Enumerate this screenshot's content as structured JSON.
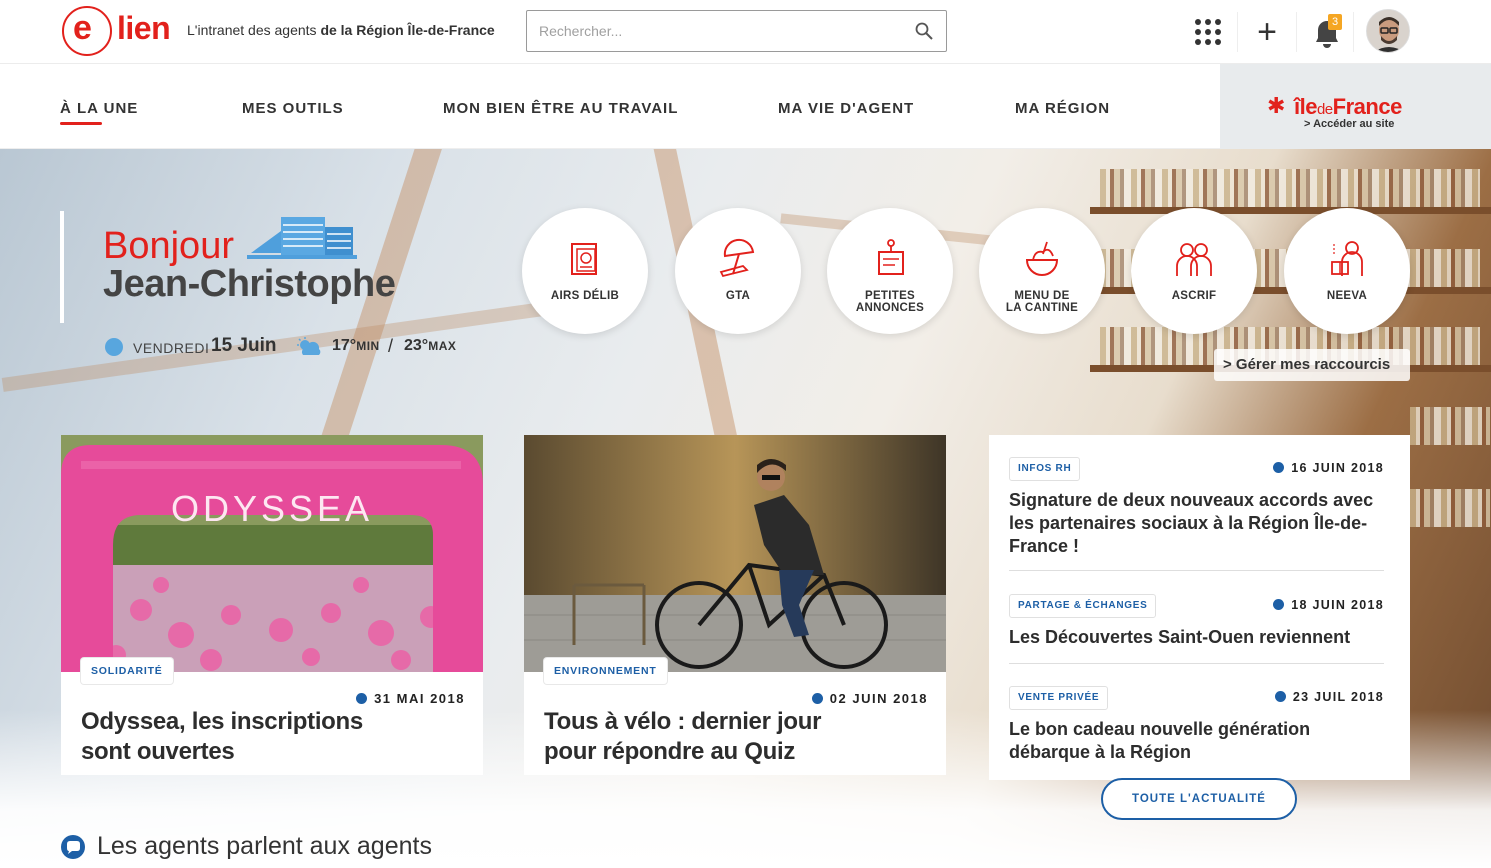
{
  "header": {
    "logo": "(e) lien",
    "tagline_prefix": "L'intranet des agents ",
    "tagline_bold": "de la Région Île-de-France",
    "search_placeholder": "Rechercher...",
    "notifications_count": "3",
    "apps_icon": "grid-icon",
    "add_icon": "plus-icon",
    "bell_icon": "bell-icon"
  },
  "nav": {
    "items": [
      {
        "label": "À LA UNE",
        "active": true
      },
      {
        "label": "MES OUTILS"
      },
      {
        "label": "MON BIEN ÊTRE AU TRAVAIL"
      },
      {
        "label": "MA VIE D'AGENT"
      },
      {
        "label": "MA RÉGION"
      }
    ],
    "region_logo_a": "île",
    "region_logo_b": "de",
    "region_logo_c": "France",
    "region_link": "> Accéder au site"
  },
  "greeting": {
    "hello": "Bonjour",
    "name": "Jean-Christophe",
    "day": "Vendredi",
    "date": "15 Juin",
    "tmin": "17°",
    "tmin_unit": "MIN",
    "tsep": "/",
    "tmax": "23°",
    "tmax_unit": "MAX"
  },
  "shortcuts": [
    {
      "label1": "AIRS DÉLIB",
      "label2": "",
      "icon": "document-icon"
    },
    {
      "label1": "GTA",
      "label2": "",
      "icon": "beach-umbrella-icon"
    },
    {
      "label1": "PETITES",
      "label2": "ANNONCES",
      "icon": "announcement-board-icon"
    },
    {
      "label1": "MENU DE",
      "label2": "LA CANTINE",
      "icon": "food-icon"
    },
    {
      "label1": "ASCRIF",
      "label2": "",
      "icon": "people-icon"
    },
    {
      "label1": "NEEVA",
      "label2": "",
      "icon": "reader-icon"
    }
  ],
  "manage_shortcuts": "> Gérer mes raccourcis",
  "cards": [
    {
      "tag": "SOLIDARITÉ",
      "date": "31 MAI 2018",
      "title": "Odyssea, les inscriptions sont ouvertes",
      "image_text": "ODYSSEA"
    },
    {
      "tag": "ENVIRONNEMENT",
      "date": "02 JUIN 2018",
      "title": "Tous à vélo : dernier jour pour répondre au Quiz"
    }
  ],
  "news": [
    {
      "tag": "INFOS RH",
      "date": "16 JUIN 2018",
      "title": "Signature de deux nouveaux accords avec les partenaires sociaux à la Région Île-de-France !"
    },
    {
      "tag": "PARTAGE & ÉCHANGES",
      "date": "18 JUIN 2018",
      "title": "Les Découvertes Saint-Ouen reviennent"
    },
    {
      "tag": "VENTE PRIVÉE",
      "date": "23 JUIL 2018",
      "title": "Le bon cadeau nouvelle génération débarque à la Région"
    }
  ],
  "all_news_button": "TOUTE L'ACTUALITÉ",
  "section_title": "Les agents parlent aux agents",
  "colors": {
    "accent_red": "#e2211c",
    "accent_blue": "#1d5fa6",
    "badge": "#f5a623"
  }
}
